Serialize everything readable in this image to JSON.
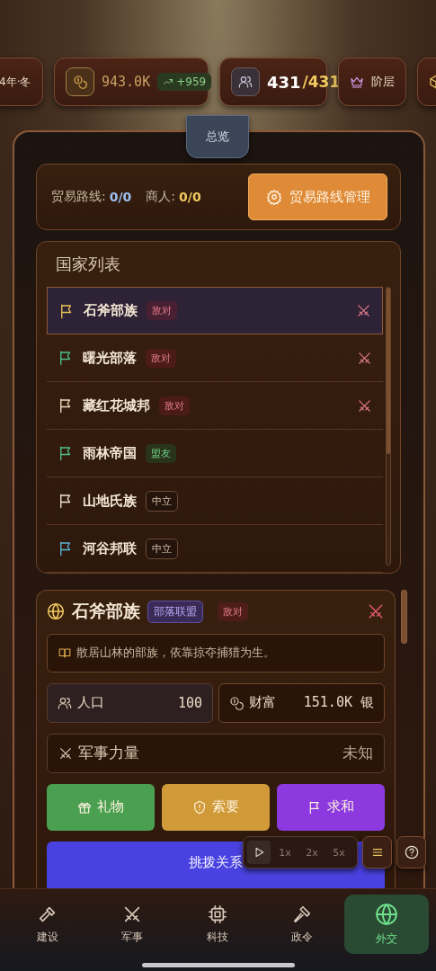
{
  "top_bar": {
    "season": "4年·冬",
    "money": {
      "value": "943.0K",
      "change": "+959"
    },
    "population": {
      "current": "431",
      "max": "/431"
    },
    "class_button": "阶层"
  },
  "tab": {
    "label": "总览",
    "selected": true
  },
  "trade": {
    "routes_label": "贸易路线:",
    "routes_value": "0/0",
    "merchants_label": "商人:",
    "merchants_value": "0/0",
    "button": "贸易路线管理"
  },
  "nations": {
    "title": "国家列表",
    "items": [
      {
        "name": "石斧部族",
        "relation": "敌对",
        "kind": "hostile",
        "color": "#e8c35a",
        "at_war": true,
        "selected": true
      },
      {
        "name": "曙光部落",
        "relation": "敌对",
        "kind": "hostile",
        "color": "#4fc08d",
        "at_war": true,
        "selected": false
      },
      {
        "name": "藏红花城邦",
        "relation": "敌对",
        "kind": "hostile",
        "color": "#eedcc0",
        "at_war": true,
        "selected": false
      },
      {
        "name": "雨林帝国",
        "relation": "盟友",
        "kind": "ally",
        "color": "#4fc08d",
        "at_war": false,
        "selected": false
      },
      {
        "name": "山地氏族",
        "relation": "中立",
        "kind": "neutral",
        "color": "#f0e6d6",
        "at_war": false,
        "selected": false
      },
      {
        "name": "河谷邦联",
        "relation": "中立",
        "kind": "neutral",
        "color": "#5ab4d8",
        "at_war": false,
        "selected": false
      }
    ]
  },
  "detail": {
    "name": "石斧部族",
    "type_badge": "部落联盟",
    "relation": "敌对",
    "kind": "hostile",
    "at_war": true,
    "description": "散居山林的部族，依靠掠夺捕猎为生。",
    "stats": [
      {
        "kind": "population",
        "label": "人口",
        "value": "100"
      },
      {
        "kind": "wealth",
        "label": "财富",
        "value": "151.0K 银"
      }
    ],
    "military": {
      "label": "军事力量",
      "value": "未知"
    },
    "actions": [
      {
        "kind": "gift",
        "label": "礼物"
      },
      {
        "kind": "demand",
        "label": "索要"
      },
      {
        "kind": "peace",
        "label": "求和"
      }
    ],
    "wide_action": "挑拨关系"
  },
  "speed_control": {
    "playing": false,
    "speeds": [
      {
        "label": "1x",
        "selected": false
      },
      {
        "label": "2x",
        "selected": false
      },
      {
        "label": "5x",
        "selected": false
      }
    ]
  },
  "bottom_nav": [
    {
      "label": "建设",
      "selected": false
    },
    {
      "label": "军事",
      "selected": false
    },
    {
      "label": "科技",
      "selected": false
    },
    {
      "label": "政令",
      "selected": false
    },
    {
      "label": "外交",
      "selected": true
    }
  ]
}
